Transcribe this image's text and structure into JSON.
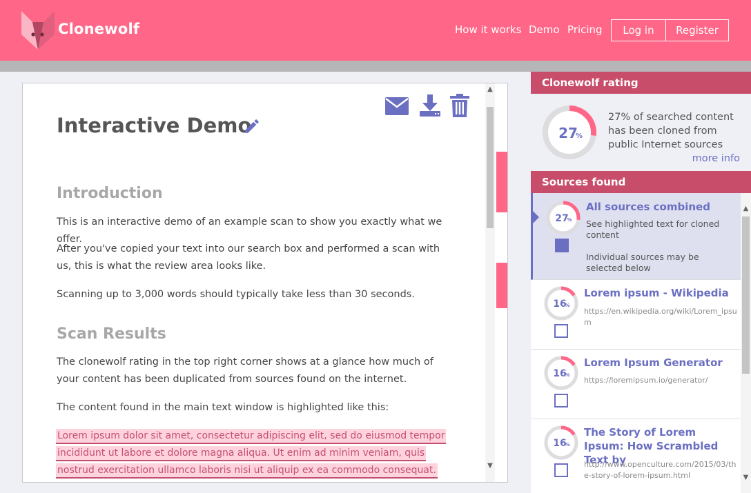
{
  "header": {
    "brand": "Clonewolf",
    "nav": [
      "How it works",
      "Demo",
      "Pricing"
    ],
    "login_label": "Log in",
    "register_label": "Register"
  },
  "document": {
    "title": "Interactive Demo",
    "sections": [
      {
        "heading": "Introduction",
        "paragraphs": [
          "This is an interactive demo of an example scan to show you exactly what we offer.",
          "After you've copied your text into our search box and performed a scan with us, this is what the review area looks like.",
          "Scanning up to 3,000 words should typically take less than 30 seconds."
        ]
      },
      {
        "heading": "Scan Results",
        "paragraphs": [
          "The clonewolf rating in the top right corner shows at a glance how much of your content has been duplicated from sources found on the internet.",
          "The content found in the main text window is highlighted like this:"
        ]
      }
    ],
    "highlight_lines": [
      "Lorem ipsum dolor sit amet, consectetur adipiscing elit, sed do eiusmod tempor",
      "incididunt ut labore et dolore magna aliqua. Ut enim ad minim veniam, quis",
      "nostrud exercitation ullamco laboris nisi ut aliquip ex ea commodo consequat."
    ]
  },
  "rating": {
    "heading": "Clonewolf rating",
    "percent": 27,
    "percent_number": "27",
    "percent_sign": "%",
    "description": "27% of searched content has been cloned from public Internet sources",
    "more_info": "more info"
  },
  "sources": {
    "heading": "Sources found",
    "items": [
      {
        "percent": 27,
        "percent_number": "27",
        "title": "All sources combined",
        "desc1": "See highlighted text for cloned content",
        "desc2": "Individual sources may be selected below",
        "checked": true
      },
      {
        "percent": 16,
        "percent_number": "16",
        "title": "Lorem ipsum - Wikipedia",
        "url": "https://en.wikipedia.org/wiki/Lorem_ipsum",
        "checked": false
      },
      {
        "percent": 16,
        "percent_number": "16",
        "title": "Lorem Ipsum Generator",
        "url": "https://loremipsum.io/generator/",
        "checked": false
      },
      {
        "percent": 16,
        "percent_number": "16",
        "title": "The Story of Lorem Ipsum: How Scrambled Text by",
        "url": "http://www.openculture.com/2015/03/the-story-of-lorem-ipsum.html",
        "checked": false
      }
    ]
  },
  "colors": {
    "brand_pink": "#ff6687",
    "accent_purple": "#6b6fc2",
    "highlight_text": "#c24f72",
    "highlight_bg": "#ffd3dd"
  },
  "icons": [
    "wolf-logo-icon",
    "pencil-icon",
    "envelope-icon",
    "download-icon",
    "trash-icon"
  ]
}
